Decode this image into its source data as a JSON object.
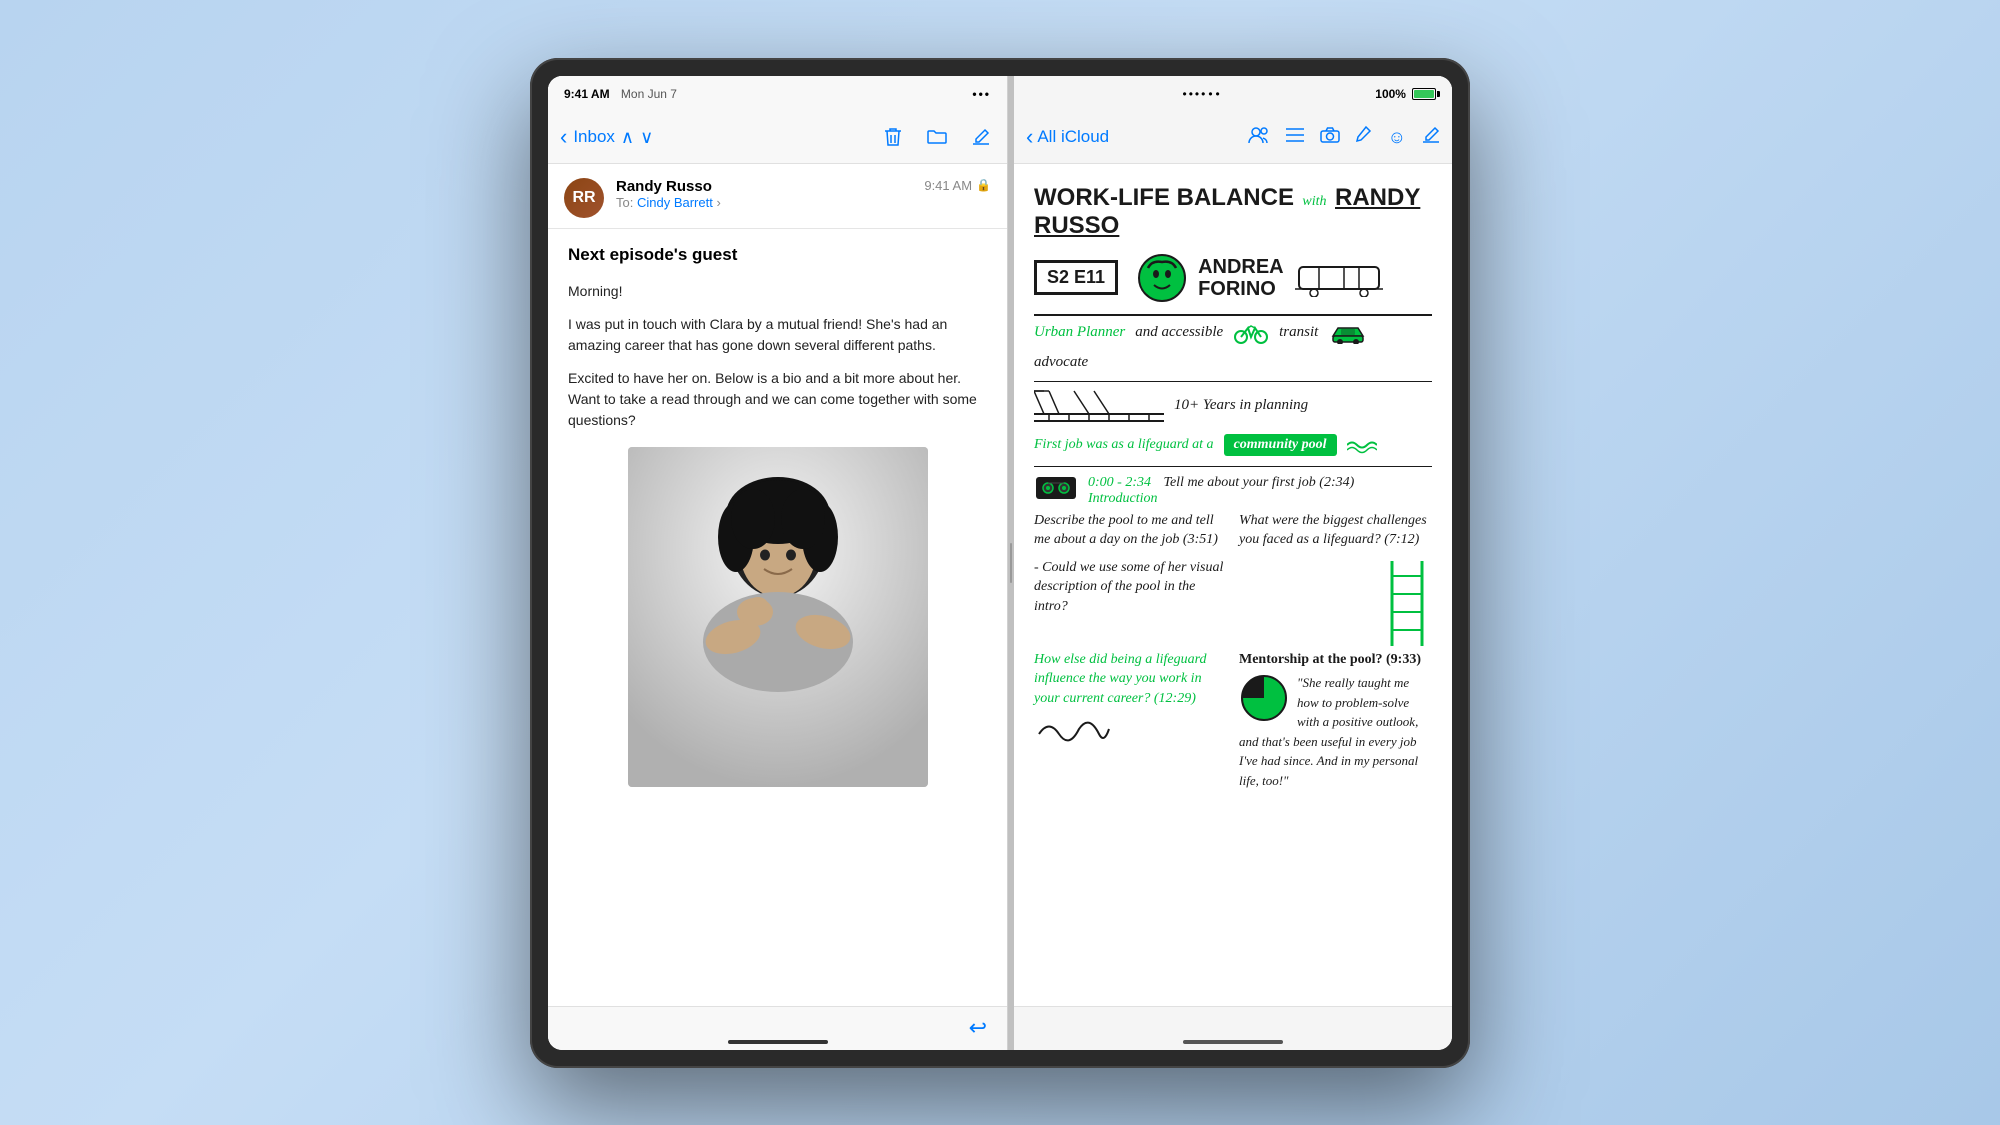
{
  "device": {
    "type": "iPad",
    "time": "9:41 AM",
    "date": "Mon Jun 7",
    "battery_pct": "100%"
  },
  "mail_panel": {
    "status_time": "9:41 AM",
    "status_date": "Mon Jun 7",
    "inbox_label": "Inbox",
    "sender": "Randy Russo",
    "recipient": "Cindy Barrett",
    "email_time": "9:41 AM",
    "subject": "Next episode's guest",
    "body_line1": "Morning!",
    "body_line2": "I was put in touch with Clara by a mutual friend! She's had an amazing career that has gone down several different paths.",
    "body_line3": "Excited to have her on. Below is a bio and a bit more about her. Want to take a read through and we can come together with some questions?"
  },
  "notes_panel": {
    "all_icloud_label": "All iCloud",
    "title_line1": "WORK-LIFE BALANCE",
    "title_with_label": "with",
    "title_name": "RANDY RUSSO",
    "episode": "S2 E11",
    "guest_first": "ANDREA",
    "guest_last": "FORINO",
    "role": "Urban Planner",
    "role2": "and accessible",
    "role3": "transit",
    "role4": "advocate",
    "years": "10+ Years in planning",
    "first_job": "First job was as a lifeguard at a",
    "community_pool": "community pool",
    "timestamp1": "0:00 - 2:34",
    "section1": "Introduction",
    "tell_about": "Tell me about your first job (2:34)",
    "question1": "Describe the pool to me and tell me about a day on the job (3:51)",
    "question2": "- Could we use some of her visual description of the pool in the intro?",
    "question3_title": "What were the biggest challenges you faced as a lifeguard? (7:12)",
    "question4": "How else did being a lifeguard influence the way you work in your current career? (12:29)",
    "mentorship": "Mentorship at the pool? (9:33)",
    "quote": "\"She really taught me how to problem-solve with a positive outlook, and that's been useful in every job I've had since. And in my personal life, too!\""
  }
}
